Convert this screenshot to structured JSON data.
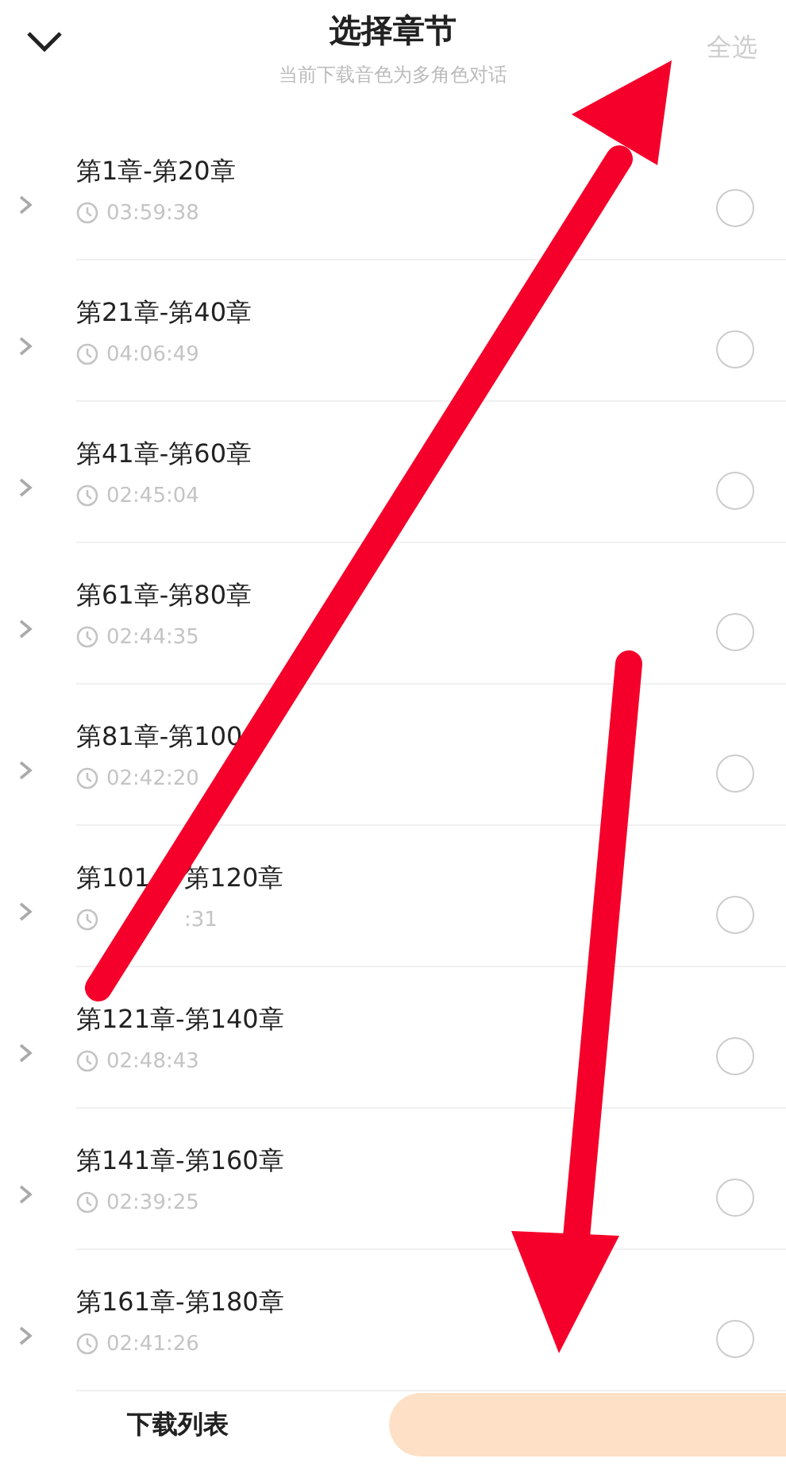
{
  "header": {
    "title": "选择章节",
    "subtitle": "当前下载音色为多角色对话",
    "select_all": "全选"
  },
  "chapters": [
    {
      "title": "第1章-第20章",
      "duration": "03:59:38",
      "selected": false
    },
    {
      "title": "第21章-第40章",
      "duration": "04:06:49",
      "selected": false
    },
    {
      "title": "第41章-第60章",
      "duration": "02:45:04",
      "selected": false
    },
    {
      "title": "第61章-第80章",
      "duration": "02:44:35",
      "selected": false
    },
    {
      "title": "第81章-第100",
      "duration": "02:42:20",
      "selected": false
    },
    {
      "title": [
        "第101",
        "第120章"
      ],
      "duration": [
        ":31"
      ],
      "selected": false
    },
    {
      "title": "第121章-第140章",
      "duration": "02:48:43",
      "selected": false
    },
    {
      "title": "第141章-第160章",
      "duration": "02:39:25",
      "selected": false
    },
    {
      "title": "第161章-第180章",
      "duration": "02:41:26",
      "selected": false
    }
  ],
  "footer": {
    "download_list": "下载列表"
  }
}
